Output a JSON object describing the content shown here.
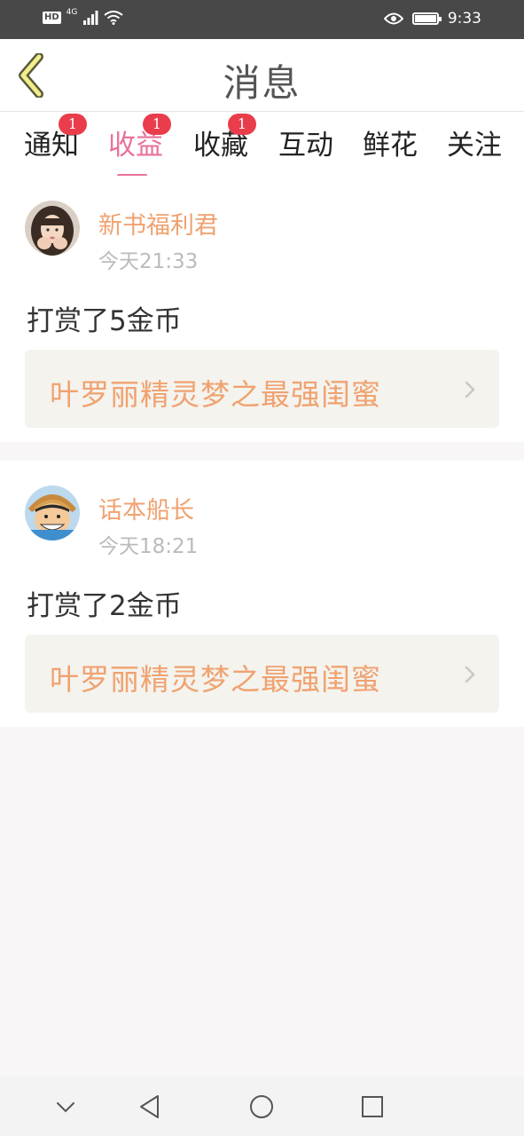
{
  "status_bar": {
    "hd": "HD",
    "network": "4G",
    "time": "9:33",
    "icons": [
      "signal-icon",
      "wifi-icon",
      "eye-icon",
      "battery-icon"
    ]
  },
  "header": {
    "title": "消息",
    "back_icon": "back-chevron-icon"
  },
  "tabs": [
    {
      "label": "通知",
      "badge": "1",
      "active": false
    },
    {
      "label": "收益",
      "badge": "1",
      "active": true
    },
    {
      "label": "收藏",
      "badge": "1",
      "active": false
    },
    {
      "label": "互动",
      "badge": "",
      "active": false
    },
    {
      "label": "鲜花",
      "badge": "",
      "active": false
    },
    {
      "label": "关注",
      "badge": "",
      "active": false
    }
  ],
  "messages": [
    {
      "username": "新书福利君",
      "time": "今天21:33",
      "text": "打赏了5金币",
      "book_title": "叶罗丽精灵梦之最强闺蜜",
      "avatar": "user-avatar-girl"
    },
    {
      "username": "话本船长",
      "time": "今天18:21",
      "text": "打赏了2金币",
      "book_title": "叶罗丽精灵梦之最强闺蜜",
      "avatar": "user-avatar-cartoon"
    }
  ],
  "nav_bar": {
    "icons": [
      "collapse-icon",
      "back-triangle-icon",
      "home-circle-icon",
      "recents-square-icon"
    ]
  },
  "colors": {
    "accent": "#e9719a",
    "username": "#f0a270",
    "badge": "#ea3d4c"
  }
}
